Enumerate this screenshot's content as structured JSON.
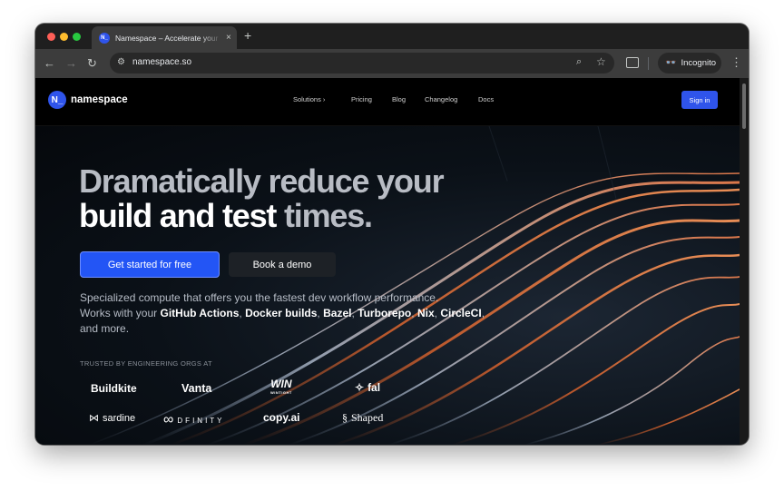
{
  "browser": {
    "tab_title": "Namespace – Accelerate your",
    "tab_favicon": "N_",
    "tab_close": "×",
    "new_tab": "+",
    "url": "namespace.so",
    "profile_label": "Incognito",
    "icons": {
      "back": "←",
      "forward": "→",
      "reload": "↻",
      "site_info": "⚙",
      "zoom": "⌕",
      "bookmark": "☆",
      "incognito": "👓",
      "menu": "⋮"
    }
  },
  "nav": {
    "brand_mark": "N_",
    "brand_name": "namespace",
    "links": [
      "Solutions ›",
      "Pricing",
      "Blog",
      "Changelog",
      "Docs"
    ],
    "sign_in": "Sign in"
  },
  "hero": {
    "headline_line1": "Dramatically reduce your",
    "headline_line2_bold": "build and test",
    "headline_line2_muted": "times.",
    "cta_primary": "Get started for free",
    "cta_secondary": "Book a demo",
    "sub_line1": "Specialized compute that offers you the fastest dev workflow performance.",
    "sub_prefix": "Works with your",
    "sub_tool1": "GitHub Actions",
    "sub_tool2": "Docker builds",
    "sub_tool3": "Bazel",
    "sub_tool4": "Turborepo",
    "sub_tool5": "Nix",
    "sub_tool6": "CircleCI",
    "sub_sep": ",",
    "sub_suffix": "and more.",
    "trusted_label": "TRUSTED BY ENGINEERING ORGS AT",
    "logos": {
      "buildkite": "Buildkite",
      "vanta": "Vanta",
      "wiz": "WIN",
      "wiz_small": "WINTIGHT",
      "fal_glyph": "✧",
      "fal": "fal",
      "sardine_glyph": "⋈",
      "sardine": "sardine",
      "dfinity_glyph": "∞",
      "dfinity": "DFINITY",
      "copyai": "copy.ai",
      "shaped_glyph": "§",
      "shaped": "Shaped"
    }
  },
  "colors": {
    "accent": "#2355f5",
    "page_bg": "#000000",
    "browser_chrome": "#3c3c3c"
  }
}
